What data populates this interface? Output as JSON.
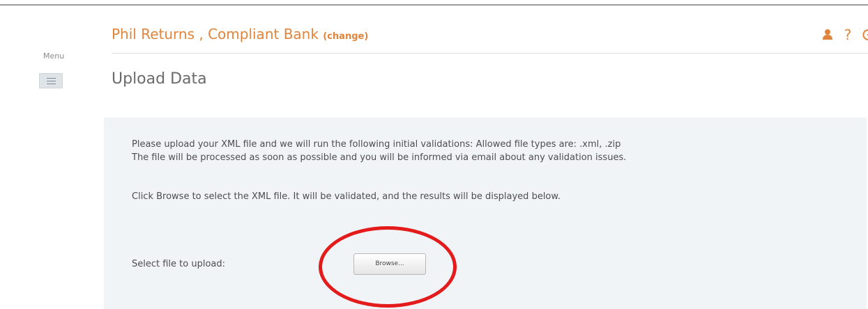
{
  "menu": {
    "label": "Menu",
    "button_icon": "hamburger-menu-icon"
  },
  "header": {
    "title": "Phil Returns , Compliant Bank ",
    "change_link": "(change)",
    "icons": {
      "user": "user-icon",
      "help_glyph": "?",
      "logout": "logout-icon"
    }
  },
  "page": {
    "title": "Upload Data"
  },
  "upload_panel": {
    "instruction_line1": "Please upload your XML file and we will run the following initial validations: Allowed file types are: .xml, .zip",
    "instruction_line2": "The file will be processed as soon as possible and you will be informed via email about any validation issues.",
    "instruction_line3": "Click Browse to select the XML file. It will be validated, and the results will be displayed below.",
    "select_file_label": "Select file to upload:",
    "browse_button_label": "Browse..."
  },
  "colors": {
    "accent": "#e0843c",
    "panel_background": "#f1f4f7",
    "annotation_circle": "#e31b1b"
  }
}
